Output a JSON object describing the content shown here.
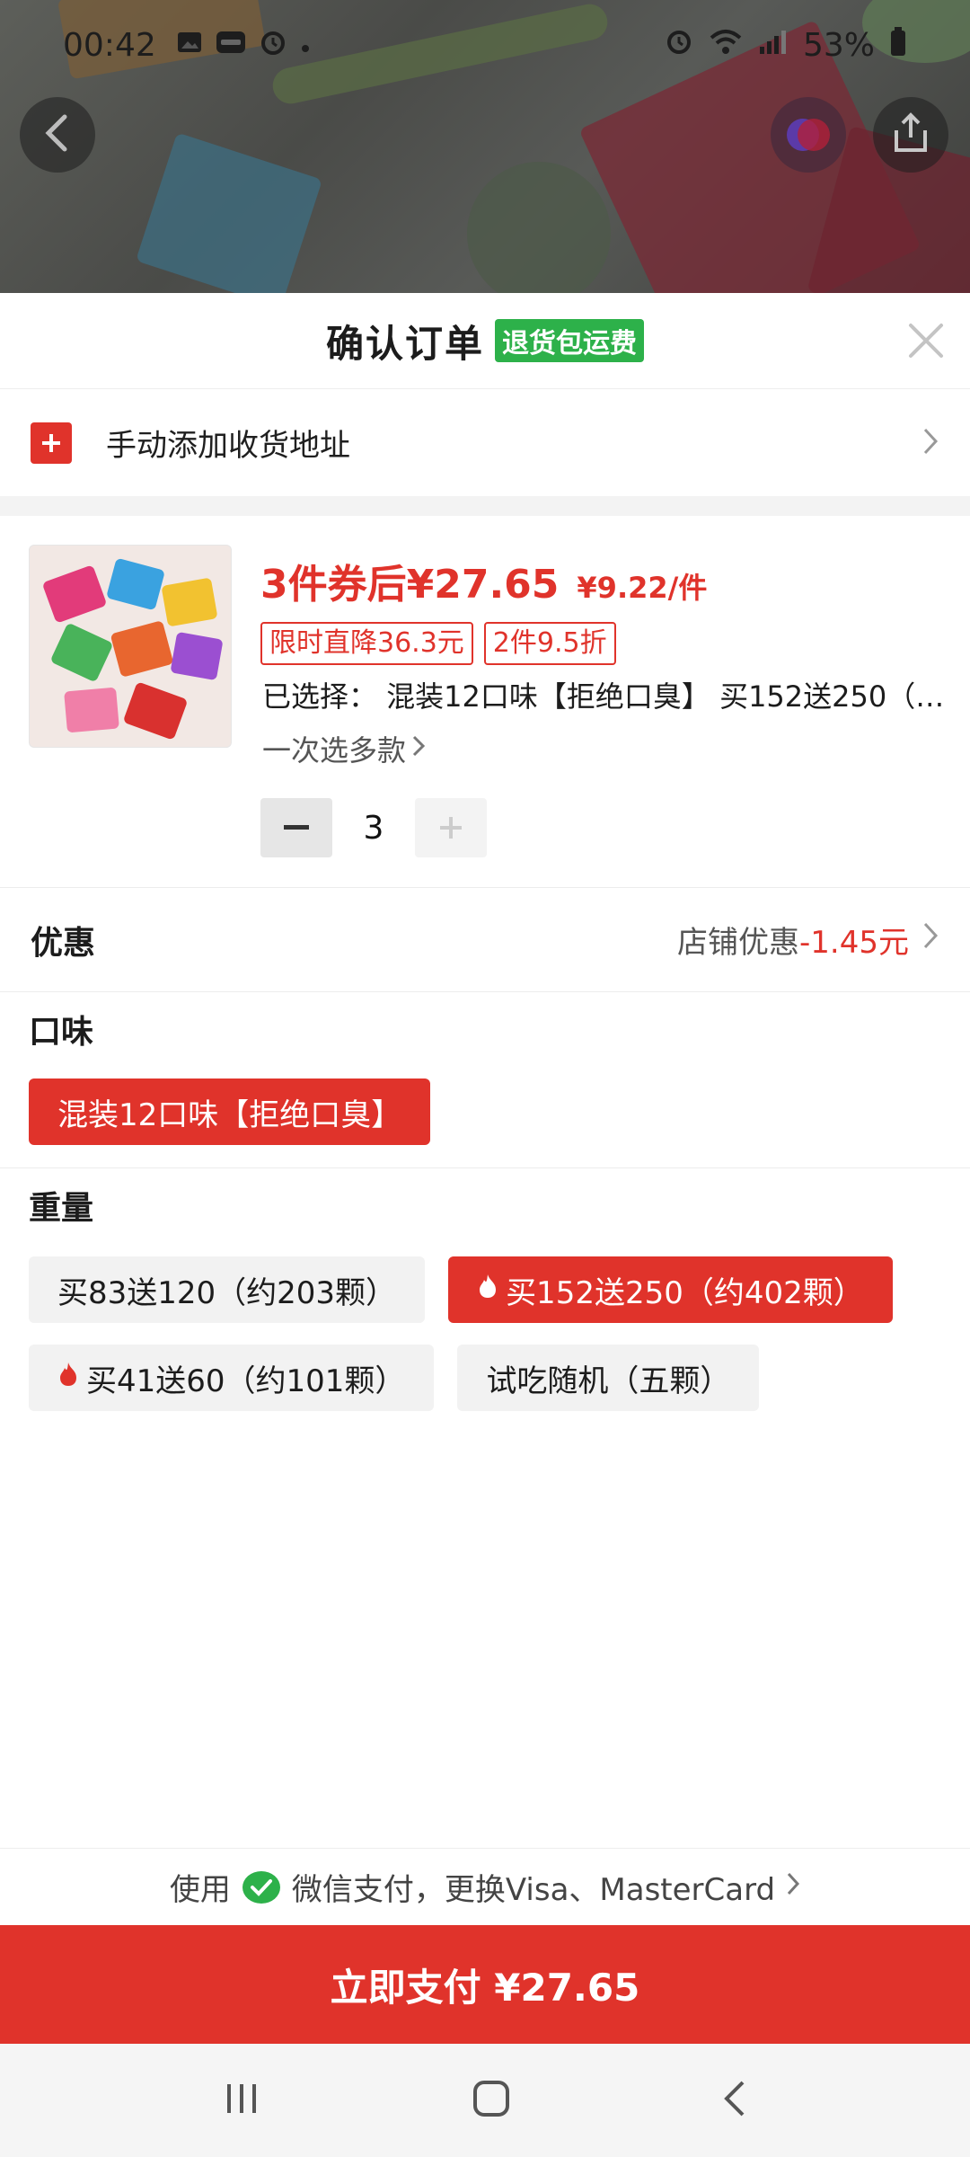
{
  "status_bar": {
    "time": "00:42",
    "battery": "53%",
    "icons": [
      "gallery-icon",
      "zalo-icon",
      "alarm-icon",
      "dot-icon",
      "alarm-icon",
      "wifi-icon",
      "signal-icon",
      "battery-icon"
    ]
  },
  "top_overlay": {
    "back_icon": "chevron-left-icon",
    "share_icon": "share-icon"
  },
  "sheet": {
    "title": "确认订单",
    "badge": "退货包运费",
    "close_icon": "close-icon"
  },
  "address": {
    "label": "手动添加收货地址"
  },
  "product": {
    "price_label": "3件券后¥27.65",
    "unit_price": "¥9.22/件",
    "tags": [
      "限时直降36.3元",
      "2件9.5折"
    ],
    "selected_text": "已选择： 混装12口味【拒绝口臭】 买152送250（…",
    "multi_select": "一次选多款",
    "quantity": "3"
  },
  "discount": {
    "label": "优惠",
    "value_prefix": "店铺优惠",
    "value_amount": "-1.45元"
  },
  "flavor": {
    "label": "口味",
    "options": [
      {
        "label": "混装12口味【拒绝口臭】",
        "selected": true
      }
    ]
  },
  "weight": {
    "label": "重量",
    "options": [
      {
        "label": "买83送120（约203颗）",
        "selected": false,
        "hot": false
      },
      {
        "label": "买152送250（约402颗）",
        "selected": true,
        "hot": true
      },
      {
        "label": "买41送60（约101颗）",
        "selected": false,
        "hot": true
      },
      {
        "label": "试吃随机（五颗）",
        "selected": false,
        "hot": false
      }
    ]
  },
  "payment": {
    "prefix": "使用",
    "method": "微信支付，更换Visa、MasterCard",
    "pay_button": "立即支付 ¥27.65"
  },
  "colors": {
    "accent_red": "#e0332b",
    "badge_green": "#2db14a"
  }
}
